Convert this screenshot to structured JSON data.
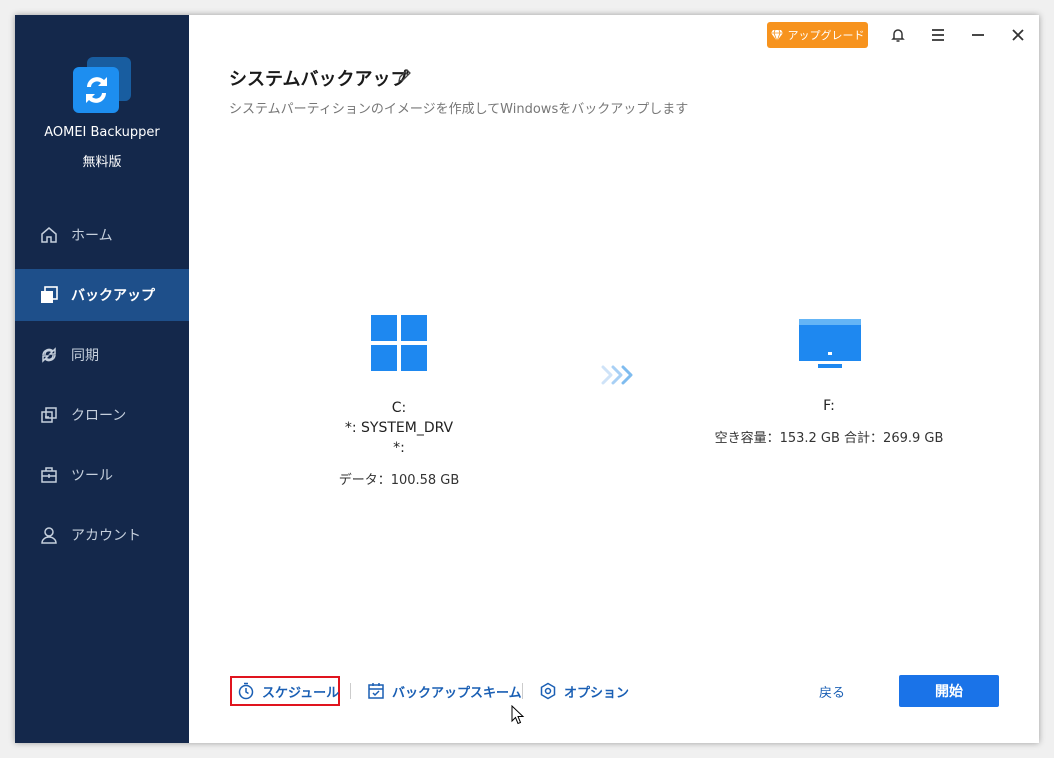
{
  "app": {
    "name": "AOMEI Backupper",
    "edition": "無料版"
  },
  "sidebar": {
    "items": [
      {
        "label": "ホーム",
        "icon": "home-icon",
        "active": false
      },
      {
        "label": "バックアップ",
        "icon": "backup-icon",
        "active": true
      },
      {
        "label": "同期",
        "icon": "sync-icon",
        "active": false
      },
      {
        "label": "クローン",
        "icon": "clone-icon",
        "active": false
      },
      {
        "label": "ツール",
        "icon": "toolbox-icon",
        "active": false
      },
      {
        "label": "アカウント",
        "icon": "user-icon",
        "active": false
      }
    ]
  },
  "header": {
    "upgrade_label": "アップグレード"
  },
  "page": {
    "title": "システムバックアップ",
    "subtitle": "システムパーティションのイメージを作成してWindowsをバックアップします"
  },
  "source": {
    "drive": "C:",
    "line2": "*: SYSTEM_DRV",
    "line3": "*:",
    "data_size": "データ：100.58 GB"
  },
  "destination": {
    "drive": "F:",
    "info": "空き容量：153.2 GB 合計：269.9 GB"
  },
  "footer": {
    "schedule_label": "スケジュール",
    "scheme_label": "バックアップスキーム",
    "options_label": "オプション",
    "back_label": "戻る",
    "start_label": "開始"
  },
  "colors": {
    "sidebar_bg": "#14284b",
    "sidebar_active": "#1e4f8a",
    "accent": "#1a73e8",
    "upgrade": "#f7931e",
    "highlight_box": "#e0141e"
  }
}
